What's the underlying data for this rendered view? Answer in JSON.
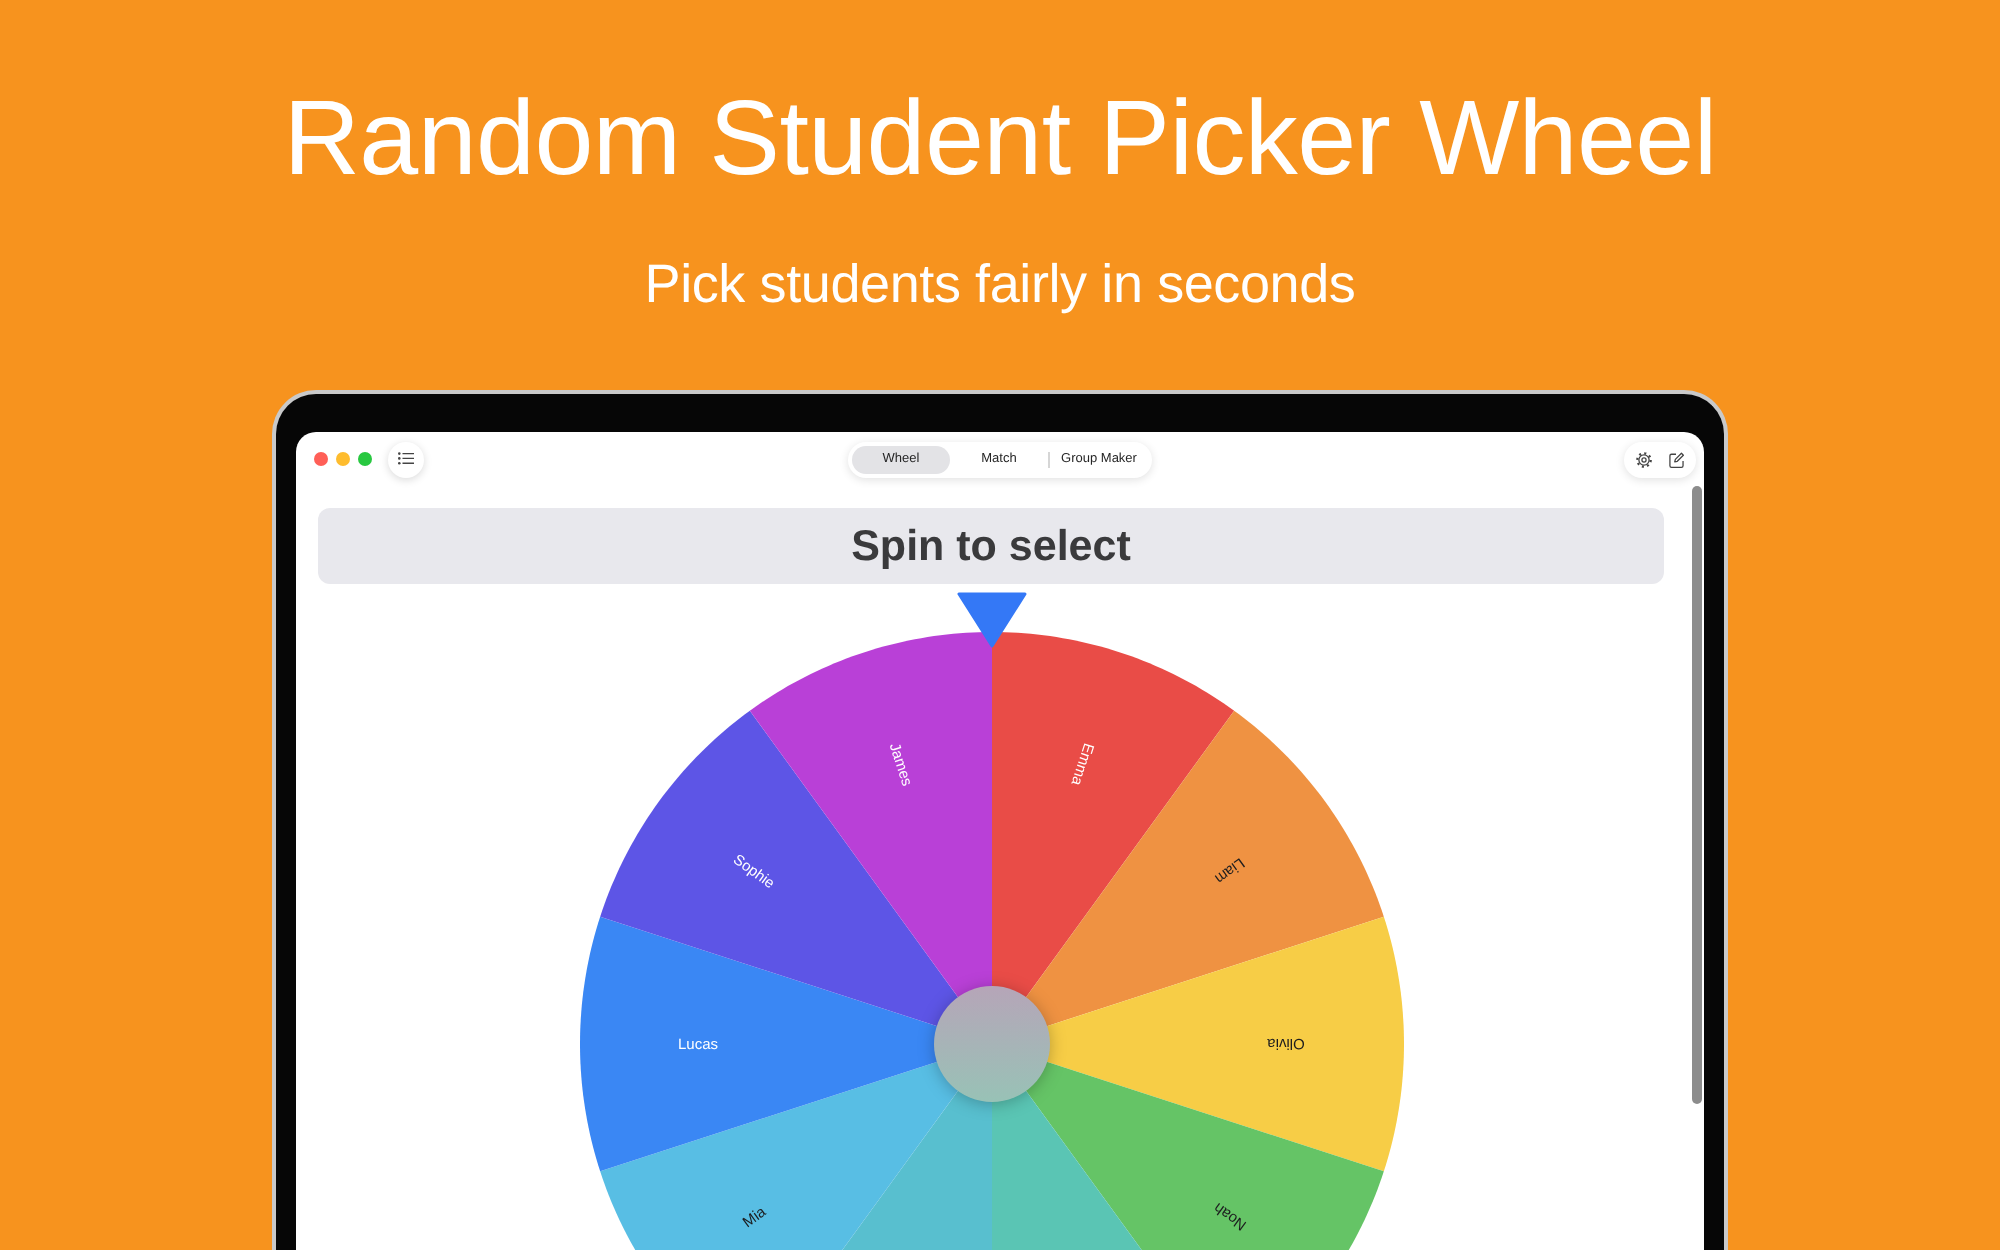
{
  "hero": {
    "title": "Random Student Picker Wheel",
    "subtitle": "Pick students fairly in seconds"
  },
  "toolbar": {
    "tabs": [
      {
        "label": "Wheel",
        "selected": true
      },
      {
        "label": "Match",
        "selected": false
      },
      {
        "label": "Group Maker",
        "selected": false
      }
    ]
  },
  "banner": {
    "text": "Spin to select"
  },
  "wheel": {
    "segments": [
      {
        "name": "Emma",
        "color": "#e94c47"
      },
      {
        "name": "Liam",
        "color": "#ef9242"
      },
      {
        "name": "Olivia",
        "color": "#f7cd46"
      },
      {
        "name": "Noah",
        "color": "#65c466"
      },
      {
        "color": "#5ac5b4"
      },
      {
        "color": "#58bfcf"
      },
      {
        "name": "Mia",
        "color": "#58bee4"
      },
      {
        "name": "Lucas",
        "color": "#3a87f4"
      },
      {
        "name": "Sophie",
        "color": "#5d55e6"
      },
      {
        "name": "James",
        "color": "#b940d7"
      }
    ]
  }
}
